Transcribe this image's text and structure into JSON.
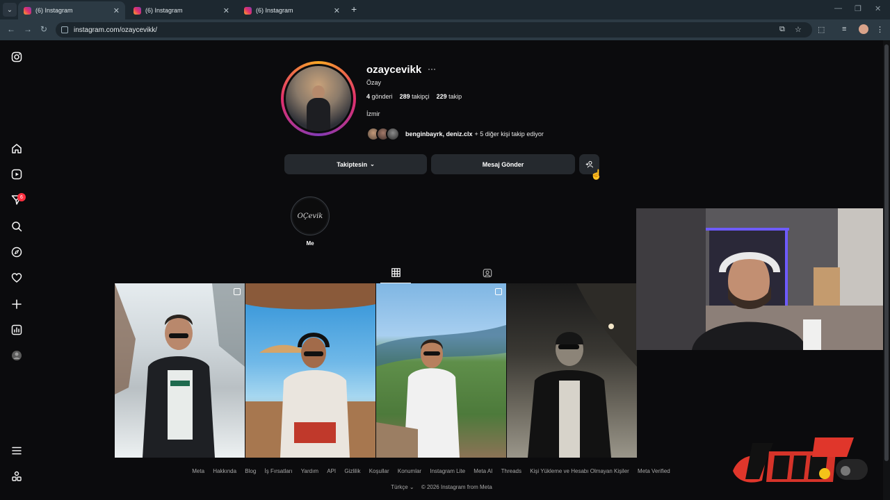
{
  "browser": {
    "tabs": [
      {
        "title": "(6) Instagram",
        "active": true
      },
      {
        "title": "(6) Instagram",
        "active": false
      },
      {
        "title": "(6) Instagram",
        "active": false
      }
    ],
    "url": "instagram.com/ozaycevikk/"
  },
  "sidebar": {
    "items": [
      {
        "icon": "instagram-logo-icon"
      },
      {
        "icon": "home-icon"
      },
      {
        "icon": "reels-icon"
      },
      {
        "icon": "messages-icon",
        "badge": "6"
      },
      {
        "icon": "search-icon"
      },
      {
        "icon": "explore-icon"
      },
      {
        "icon": "notifications-heart-icon"
      },
      {
        "icon": "create-plus-icon"
      },
      {
        "icon": "dashboard-icon"
      },
      {
        "icon": "profile-avatar-icon"
      },
      {
        "icon": "menu-icon"
      },
      {
        "icon": "also-from-meta-icon"
      }
    ]
  },
  "profile": {
    "username": "ozaycevikk",
    "more": "···",
    "full_name": "Özay",
    "posts_count": "4",
    "posts_label": "gönderi",
    "followers_count": "289",
    "followers_label": "takipçi",
    "following_count": "229",
    "following_label": "takip",
    "bio": "İzmir",
    "followed_by_names": "benginbayrk, deniz.clx",
    "followed_by_rest": "+ 5 diğer kişi takip ediyor"
  },
  "actions": {
    "following_label": "Takiptesin",
    "message_label": "Mesaj Gönder",
    "suggest_icon": "add-person-icon"
  },
  "highlights": [
    {
      "label": "Me",
      "cover_text": "OÇevik"
    }
  ],
  "content_tabs": [
    {
      "icon": "grid-icon",
      "active": true
    },
    {
      "icon": "tagged-icon",
      "active": false
    }
  ],
  "posts": [
    {
      "scene": "snow",
      "multiple": true
    },
    {
      "scene": "beach",
      "multiple": false
    },
    {
      "scene": "coast",
      "multiple": true
    },
    {
      "scene": "night",
      "multiple": false
    }
  ],
  "footer": {
    "links": [
      "Meta",
      "Hakkında",
      "Blog",
      "İş Fırsatları",
      "Yardım",
      "API",
      "Gizlilik",
      "Koşullar",
      "Konumlar",
      "Instagram Lite",
      "Meta AI",
      "Threads",
      "Kişi Yükleme ve Hesabı Olmayan Kişiler",
      "Meta Verified"
    ],
    "language": "Türkçe",
    "copyright": "© 2026 Instagram from Meta"
  },
  "colors": {
    "background": "#0b0b0d",
    "button": "#25292e",
    "badge": "#ff3040",
    "chrome": "#2c3a44"
  }
}
